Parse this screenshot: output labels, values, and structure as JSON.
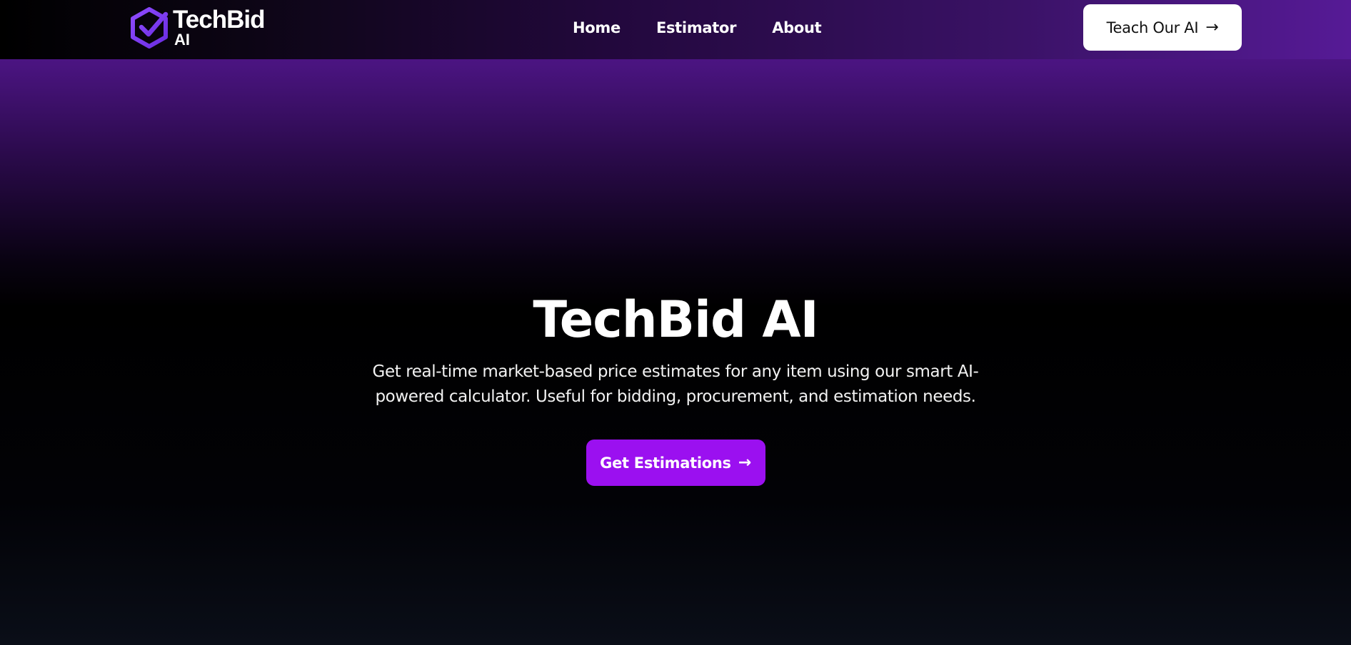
{
  "navbar": {
    "logo": {
      "title": "TechBid",
      "subtitle": "AI",
      "icon": "hexagon-check-icon",
      "color": "#7b2ff7"
    },
    "links": [
      {
        "label": "Home"
      },
      {
        "label": "Estimator"
      },
      {
        "label": "About"
      }
    ],
    "cta": {
      "label": "Teach Our AI",
      "arrow": "→"
    }
  },
  "hero": {
    "title": "TechBid AI",
    "description": "Get real-time market-based price estimates for any item using our smart AI-powered calculator. Useful for bidding, procurement, and estimation needs.",
    "cta": {
      "label": "Get Estimations",
      "arrow": "→",
      "color": "#9b10f0"
    }
  }
}
